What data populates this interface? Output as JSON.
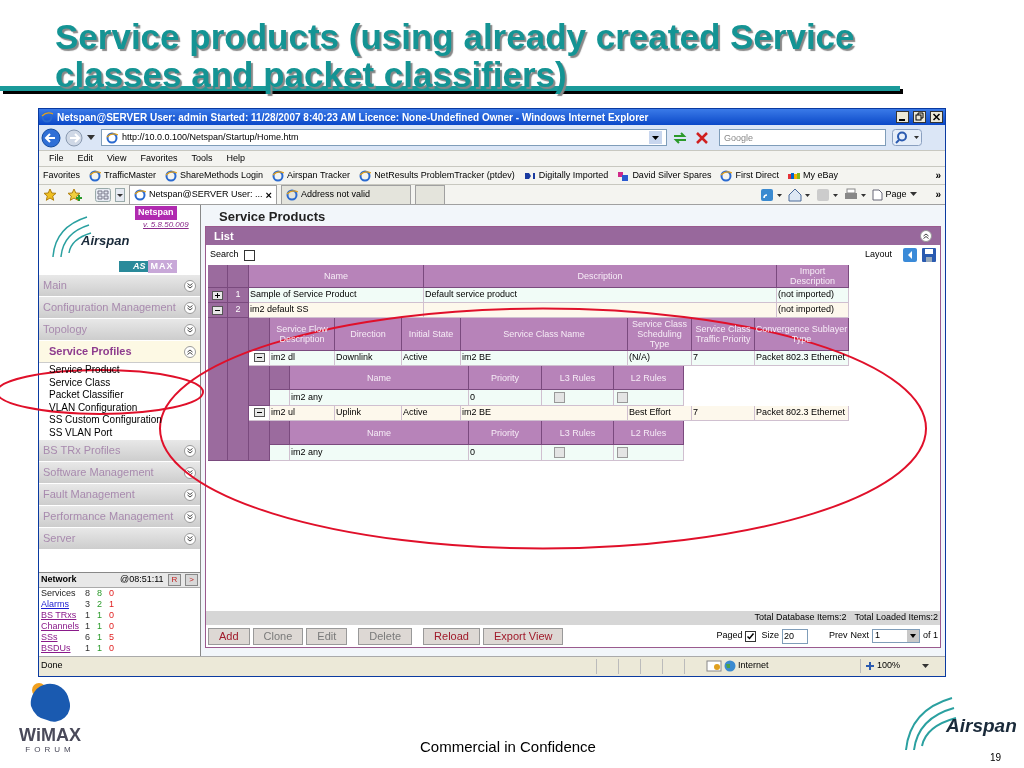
{
  "slide": {
    "title": "Service products (using already created Service classes and packet classifiers)",
    "footer": "Commercial in Confidence",
    "page_number": "19",
    "left_logo": {
      "word": "WiMAX",
      "subtitle": "FORUM"
    },
    "right_logo": "Airspan"
  },
  "browser": {
    "title": "Netspan@SERVER User: admin Started: 11/28/2007 8:40:23 AM Licence: None-Undefined Owner - Windows Internet Explorer",
    "url": "http://10.0.0.100/Netspan/Startup/Home.htm",
    "search_placeholder": "Google",
    "menu": [
      "File",
      "Edit",
      "View",
      "Favorites",
      "Tools",
      "Help"
    ],
    "favorites_label": "Favorites",
    "favorites": [
      {
        "label": "TrafficMaster",
        "kind": "ie"
      },
      {
        "label": "ShareMethods Login",
        "kind": "ie"
      },
      {
        "label": "Airspan Tracker",
        "kind": "ie"
      },
      {
        "label": "NetResults ProblemTracker (ptdev)",
        "kind": "ie"
      },
      {
        "label": "Digitally Imported",
        "kind": "di"
      },
      {
        "label": "David Silver Spares",
        "kind": "ds"
      },
      {
        "label": "First Direct",
        "kind": "ie"
      },
      {
        "label": "My eBay",
        "kind": "ebay"
      }
    ],
    "more": "»",
    "tabs": [
      {
        "label": "Netspan@SERVER User: ...",
        "selected": true,
        "close": "×"
      },
      {
        "label": "Address not valid",
        "selected": false
      }
    ],
    "page_menu": "Page",
    "status": "Done",
    "zone": "Internet",
    "zoom": "100%"
  },
  "sidebar": {
    "brand": "Netspan",
    "version": "v. 5.8.50.009",
    "logo": "Airspan",
    "product": [
      "AS",
      "MAX"
    ],
    "sections": [
      {
        "label": "Main",
        "expanded": false
      },
      {
        "label": "Configuration Management",
        "expanded": false
      },
      {
        "label": "Topology",
        "expanded": false
      },
      {
        "label": "Service Profiles",
        "expanded": true,
        "items": [
          "Service Product",
          "Service Class",
          "Packet Classifier",
          "VLAN Configuration",
          "SS Custom Configuration",
          "SS VLAN Port"
        ]
      },
      {
        "label": "BS TRx Profiles",
        "expanded": false
      },
      {
        "label": "Software Management",
        "expanded": false
      },
      {
        "label": "Fault Management",
        "expanded": false
      },
      {
        "label": "Performance Management",
        "expanded": false
      },
      {
        "label": "Server",
        "expanded": false
      }
    ],
    "network": {
      "title": "Network",
      "time": "@08:51:11",
      "buttons": [
        "R",
        ">"
      ],
      "rows": [
        {
          "label": "Services",
          "kind": "text",
          "values": [
            "8",
            "8",
            "0"
          ]
        },
        {
          "label": "Alarms",
          "kind": "link",
          "values": [
            "3",
            "2",
            "1"
          ]
        },
        {
          "label": "BS TRxs",
          "kind": "visited",
          "values": [
            "1",
            "1",
            "0"
          ]
        },
        {
          "label": "Channels",
          "kind": "visited",
          "values": [
            "1",
            "1",
            "0"
          ]
        },
        {
          "label": "SSs",
          "kind": "visited",
          "values": [
            "6",
            "1",
            "5"
          ]
        },
        {
          "label": "BSDUs",
          "kind": "visited",
          "values": [
            "1",
            "1",
            "0"
          ]
        }
      ]
    }
  },
  "main": {
    "title": "Service Products",
    "panel": "List",
    "search_label": "Search",
    "search_checked": false,
    "layout_label": "Layout",
    "columns": [
      "Name",
      "Description",
      "Import Description"
    ],
    "flow_columns": [
      "Service Flow Description",
      "Direction",
      "Initial State",
      "Service Class Name",
      "Service Class Scheduling Type",
      "Service Class Traffic Priority",
      "Convergence Sublayer Type"
    ],
    "rows": [
      {
        "number": "1",
        "name": "Sample of Service Product",
        "description": "Default service product",
        "import_description": "(not imported)",
        "expanded": false
      },
      {
        "number": "2",
        "name": "im2 default SS",
        "import_description": "(not imported)",
        "expanded": true,
        "flows": [
          {
            "expanded": true,
            "cells": [
              "im2 dl",
              "Downlink",
              "Active",
              "im2 BE",
              "(N/A)",
              "7",
              "Packet 802.3 Ethernet"
            ],
            "classifier_columns": [
              "Name",
              "Priority",
              "L3 Rules",
              "L2 Rules"
            ],
            "classifiers": [
              {
                "name": "im2 any",
                "priority": "0",
                "l3_rules": false,
                "l2_rules": false
              }
            ]
          },
          {
            "expanded": true,
            "cells": [
              "im2 ul",
              "Uplink",
              "Active",
              "im2 BE",
              "Best Effort",
              "7",
              "Packet 802.3 Ethernet"
            ],
            "classifier_columns": [
              "Name",
              "Priority",
              "L3 Rules",
              "L2 Rules"
            ],
            "classifiers": [
              {
                "name": "im2 any",
                "priority": "0",
                "l3_rules": false,
                "l2_rules": false
              }
            ]
          }
        ]
      }
    ],
    "totals": [
      "Total Database Items:2",
      "Total Loaded Items:2"
    ],
    "buttons": [
      {
        "label": "Add",
        "disabled": false
      },
      {
        "label": "Clone",
        "disabled": true
      },
      {
        "label": "Edit",
        "disabled": true
      },
      {
        "label": "Delete",
        "disabled": true
      },
      {
        "label": "Reload",
        "disabled": false
      },
      {
        "label": "Export View",
        "disabled": false
      }
    ],
    "paged_label": "Paged",
    "paged_checked": true,
    "size_label": "Size",
    "size": "20",
    "prev": "Prev",
    "next": "Next",
    "page": "1",
    "page_count": "of 1"
  }
}
